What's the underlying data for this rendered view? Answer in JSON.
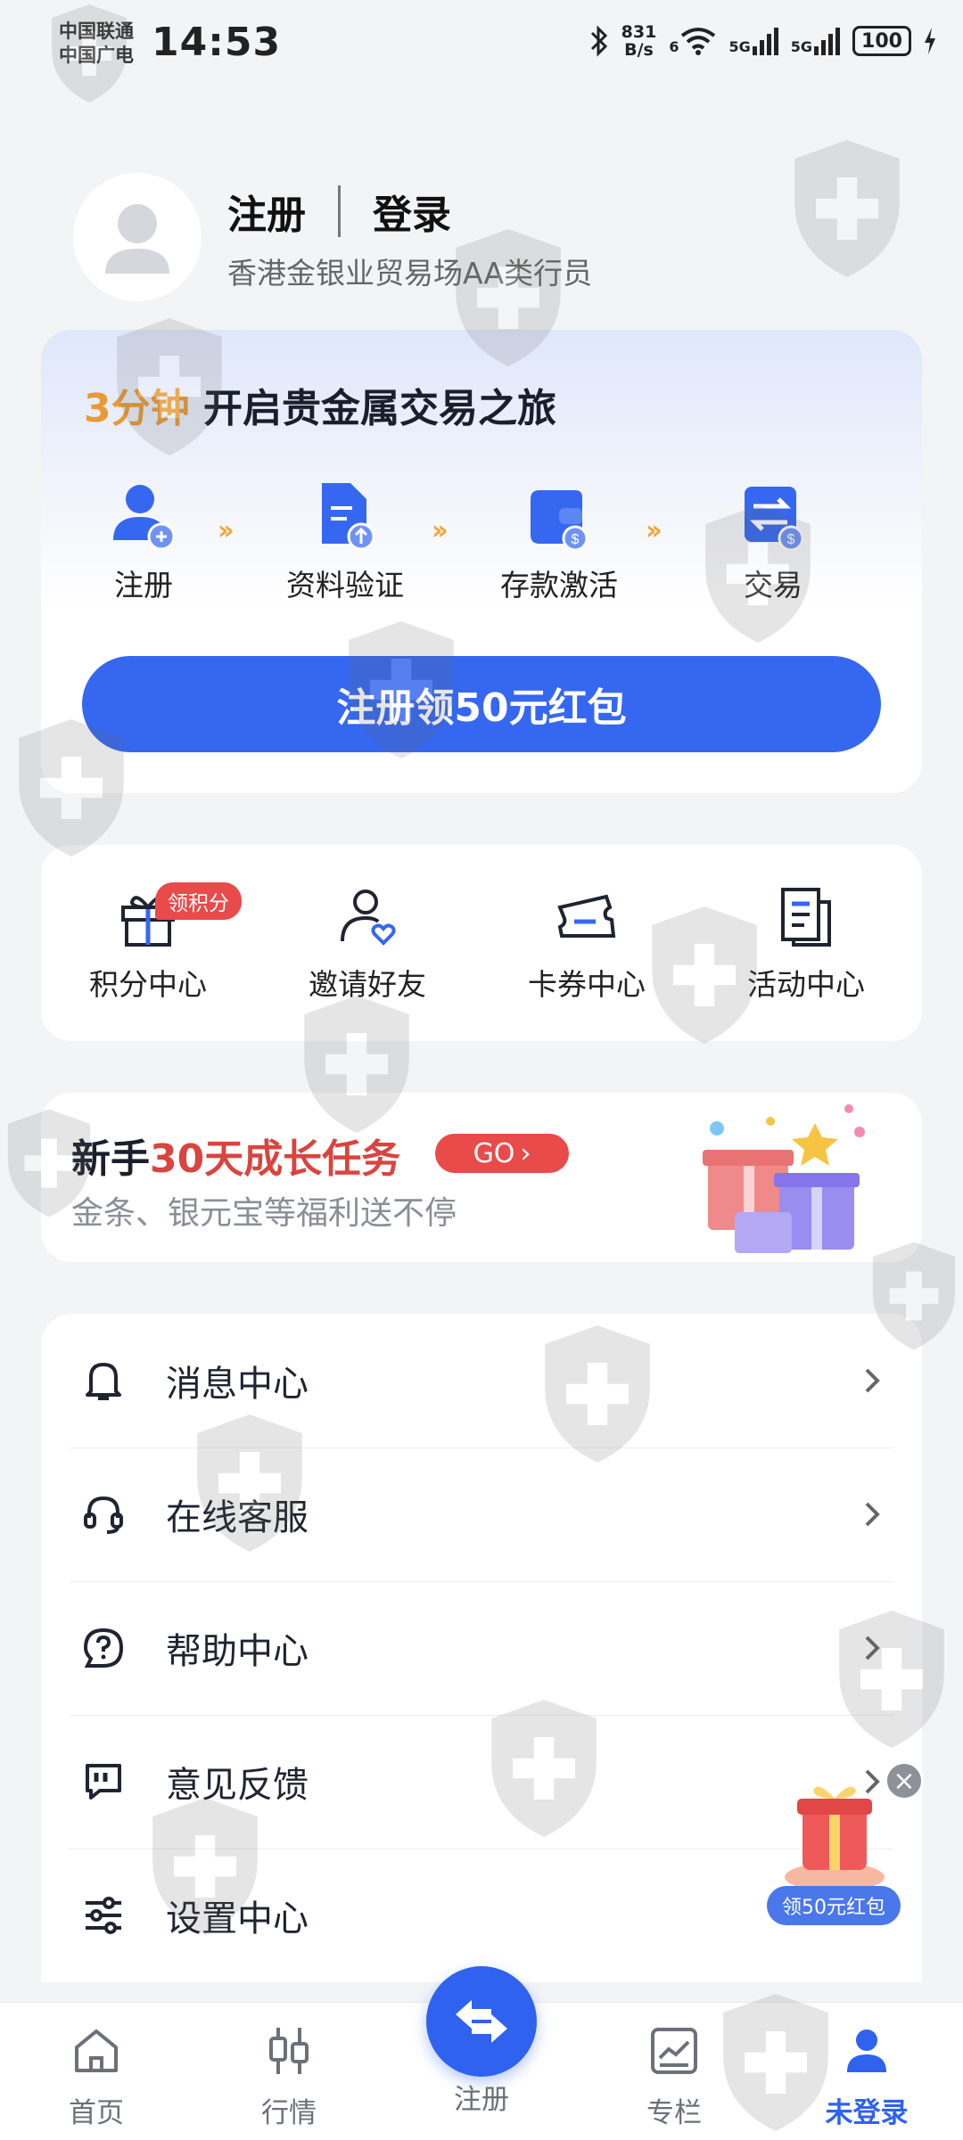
{
  "status_bar": {
    "carrier1": "中国联通",
    "carrier2": "中国广电",
    "time": "14:53",
    "net_speed_value": "831",
    "net_speed_unit": "B/s",
    "wifi_badge": "6",
    "signal1": "5G",
    "signal2": "5G",
    "battery": "100"
  },
  "user": {
    "register": "注册",
    "login": "登录",
    "subtitle": "香港金银业贸易场AA类行员"
  },
  "onboarding": {
    "title_highlight": "3分钟",
    "title_rest": "开启贵金属交易之旅",
    "steps": [
      {
        "label": "注册",
        "icon": "user-add-icon"
      },
      {
        "label": "资料验证",
        "icon": "document-upload-icon"
      },
      {
        "label": "存款激活",
        "icon": "wallet-icon"
      },
      {
        "label": "交易",
        "icon": "exchange-icon"
      }
    ],
    "cta": "注册领50元红包",
    "accent": "#3667f0"
  },
  "quick_links": {
    "badge": "领积分",
    "items": [
      {
        "label": "积分中心",
        "icon": "gift-box-icon"
      },
      {
        "label": "邀请好友",
        "icon": "invite-user-icon"
      },
      {
        "label": "卡券中心",
        "icon": "coupon-icon"
      },
      {
        "label": "活动中心",
        "icon": "activity-doc-icon"
      }
    ]
  },
  "growth_task": {
    "title_prefix": "新手",
    "title_highlight": "30天成长任务",
    "go": "GO",
    "subtitle": "金条、银元宝等福利送不停"
  },
  "menu": [
    {
      "label": "消息中心",
      "icon": "bell-icon"
    },
    {
      "label": "在线客服",
      "icon": "headset-icon"
    },
    {
      "label": "帮助中心",
      "icon": "help-bubble-icon"
    },
    {
      "label": "意见反馈",
      "icon": "feedback-quote-icon"
    },
    {
      "label": "设置中心",
      "icon": "settings-sliders-icon"
    }
  ],
  "floating_promo": {
    "label": "领50元红包"
  },
  "bottom_nav": [
    {
      "label": "首页",
      "icon": "home-icon"
    },
    {
      "label": "行情",
      "icon": "candlestick-icon"
    },
    {
      "label": "注册",
      "icon": "swap-icon"
    },
    {
      "label": "专栏",
      "icon": "chart-trend-icon"
    },
    {
      "label": "未登录",
      "icon": "user-icon"
    }
  ]
}
